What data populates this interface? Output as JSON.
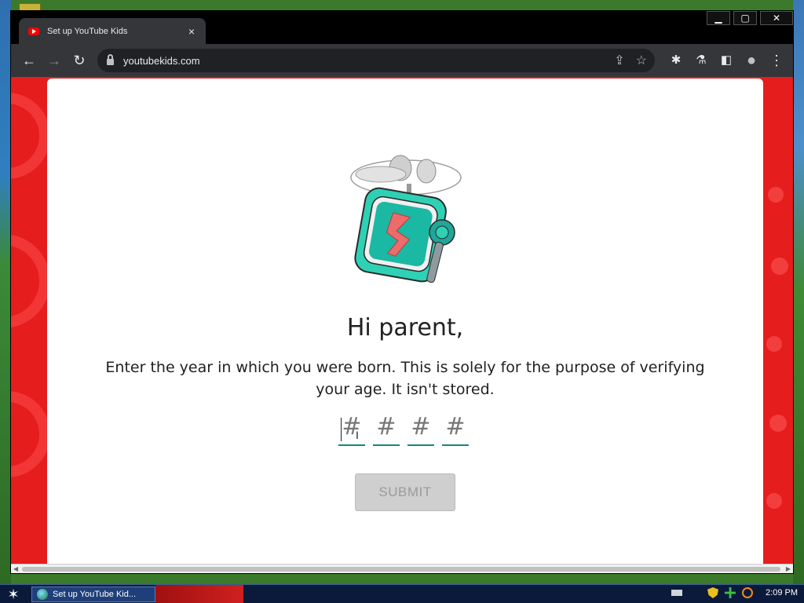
{
  "browser": {
    "tab_title": "Set up YouTube Kids",
    "tab_close": "×",
    "url": "youtubekids.com",
    "window_controls": {
      "minimize": "▁",
      "maximize": "▢",
      "close": "✕"
    },
    "nav_icons": {
      "back": "←",
      "forward": "→",
      "reload": "↻"
    },
    "toolbar_icons": {
      "share": "⇪",
      "bookmark": "☆",
      "extensions": "✱",
      "labs": "⚗",
      "sidepanel": "◧",
      "profile": "●",
      "menu": "⋮"
    }
  },
  "page": {
    "greeting": "Hi parent,",
    "instructions": "Enter the year in which you were born. This is solely for the purpose of verifying your age. It isn't stored.",
    "digit_placeholder": "#",
    "digits": [
      "",
      "",
      "",
      ""
    ],
    "submit_label": "SUBMIT"
  },
  "taskbar": {
    "task_label": "Set up YouTube Kid...",
    "clock": "2:09 PM"
  },
  "colors": {
    "brand_red": "#e51d1d",
    "input_underline": "#0f8a7f",
    "submit_disabled": "#cfcfcf"
  }
}
